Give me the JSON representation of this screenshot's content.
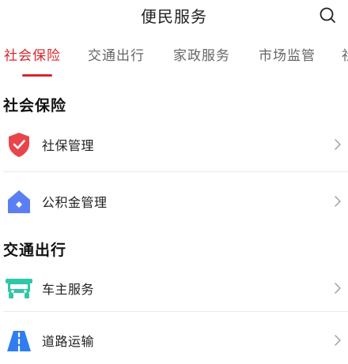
{
  "header": {
    "title": "便民服务",
    "search_icon": "search-icon"
  },
  "tabs": [
    {
      "label": "社会保险",
      "active": true
    },
    {
      "label": "交通出行",
      "active": false
    },
    {
      "label": "家政服务",
      "active": false
    },
    {
      "label": "市场监管",
      "active": false
    },
    {
      "label": "社",
      "active": false
    }
  ],
  "sections": [
    {
      "title": "社会保险",
      "items": [
        {
          "label": "社保管理",
          "icon": "shield-check-icon"
        },
        {
          "label": "公积金管理",
          "icon": "house-icon"
        }
      ]
    },
    {
      "title": "交通出行",
      "items": [
        {
          "label": "车主服务",
          "icon": "car-icon"
        },
        {
          "label": "道路运输",
          "icon": "road-icon"
        }
      ]
    }
  ],
  "colors": {
    "accent": "#d9262c",
    "shield": "#e8454a",
    "house": "#5b7ff2",
    "car": "#2ec7a8",
    "road": "#2f7df0"
  }
}
